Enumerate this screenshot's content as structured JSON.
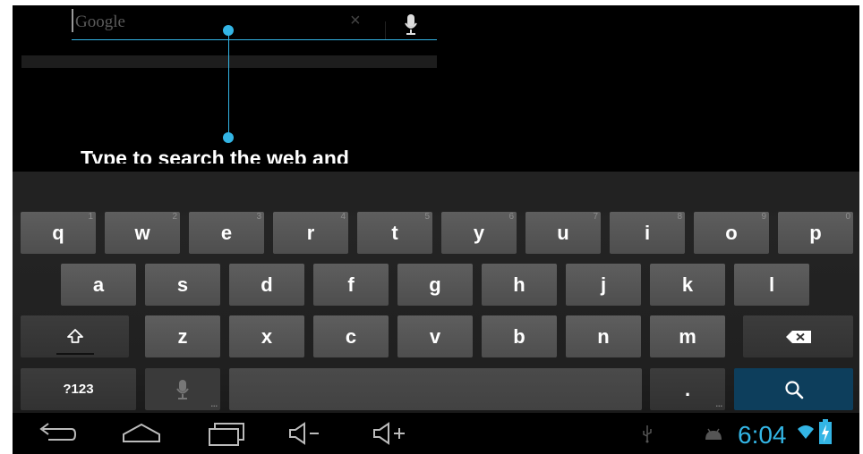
{
  "search": {
    "placeholder": "Google",
    "clear": "×"
  },
  "help_text": "Type to search the web and",
  "keyboard": {
    "row1": [
      {
        "label": "q",
        "hint": "1"
      },
      {
        "label": "w",
        "hint": "2"
      },
      {
        "label": "e",
        "hint": "3"
      },
      {
        "label": "r",
        "hint": "4"
      },
      {
        "label": "t",
        "hint": "5"
      },
      {
        "label": "y",
        "hint": "6"
      },
      {
        "label": "u",
        "hint": "7"
      },
      {
        "label": "i",
        "hint": "8"
      },
      {
        "label": "o",
        "hint": "9"
      },
      {
        "label": "p",
        "hint": "0"
      }
    ],
    "row2": [
      "a",
      "s",
      "d",
      "f",
      "g",
      "h",
      "j",
      "k",
      "l"
    ],
    "row3": [
      "z",
      "x",
      "c",
      "v",
      "b",
      "n",
      "m"
    ],
    "symbols_label": "?123",
    "period_label": ".",
    "corner_mark": "..."
  },
  "status": {
    "time": "6:04"
  },
  "colors": {
    "accent": "#33b5e5",
    "key": "#595959",
    "search_key": "#0d3e5c"
  }
}
